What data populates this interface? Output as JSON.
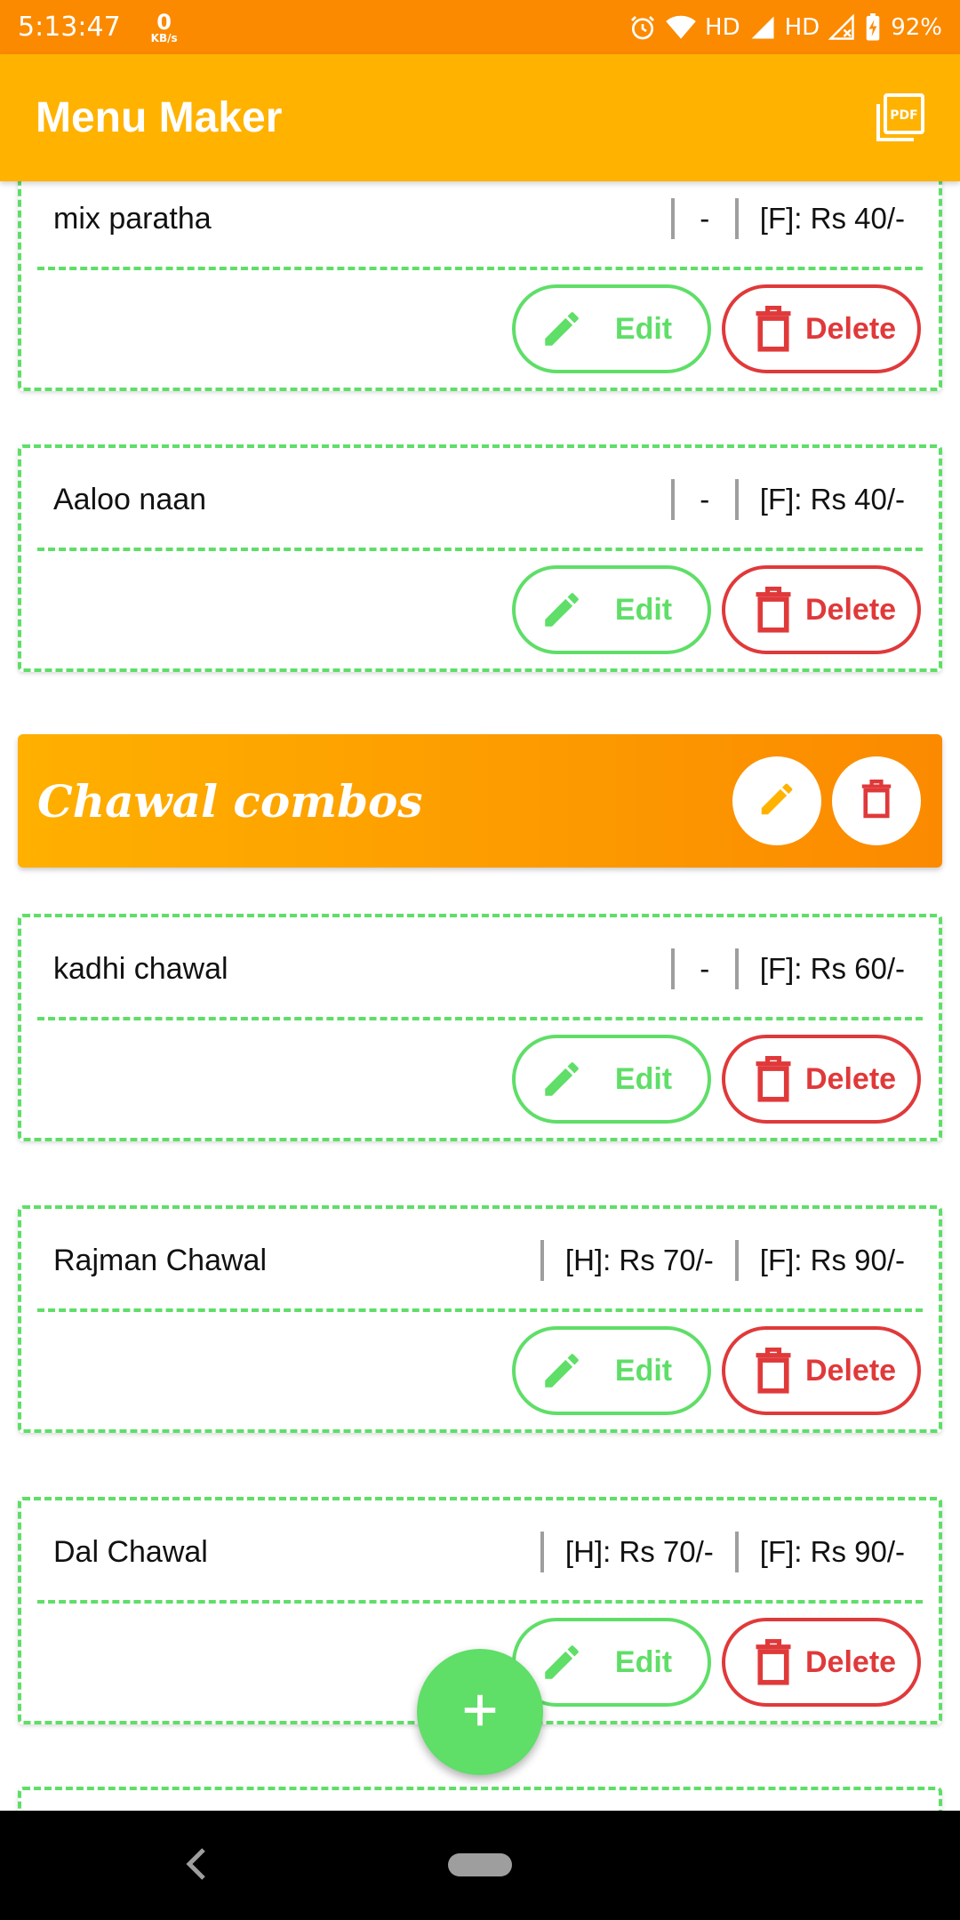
{
  "status_bar": {
    "time": "5:13:47",
    "speed_value": "0",
    "speed_unit": "KB/s",
    "hd1": "HD",
    "hd2": "HD",
    "battery": "92%"
  },
  "app_bar": {
    "title": "Menu Maker",
    "pdf_icon": "pdf-export-icon"
  },
  "items_top": [
    {
      "name": "mix paratha",
      "half": "-",
      "full": "[F]: Rs 40/-",
      "edit_label": "Edit",
      "delete_label": "Delete"
    },
    {
      "name": "Aaloo naan",
      "half": "-",
      "full": "[F]: Rs 40/-",
      "edit_label": "Edit",
      "delete_label": "Delete"
    }
  ],
  "category": {
    "title": "Chawal combos",
    "edit_icon": "pencil-icon",
    "delete_icon": "trash-icon"
  },
  "items_bottom": [
    {
      "name": "kadhi chawal",
      "half": "-",
      "full": "[F]: Rs 60/-",
      "edit_label": "Edit",
      "delete_label": "Delete"
    },
    {
      "name": "Rajman Chawal",
      "half": "[H]: Rs 70/-",
      "full": "[F]: Rs 90/-",
      "edit_label": "Edit",
      "delete_label": "Delete"
    },
    {
      "name": "Dal Chawal",
      "half": "[H]: Rs 70/-",
      "full": "[F]: Rs 90/-",
      "edit_label": "Edit",
      "delete_label": "Delete"
    }
  ],
  "fab": {
    "icon": "plus-icon"
  },
  "colors": {
    "status_bar": "#fb8a00",
    "app_bar": "#ffb200",
    "accent_green": "#5fde68",
    "danger_red": "#e0393a"
  }
}
